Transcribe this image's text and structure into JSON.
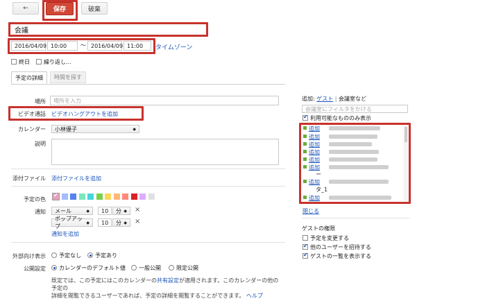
{
  "toolbar": {
    "back_label": "←",
    "save_label": "保存",
    "discard_label": "破棄"
  },
  "event": {
    "title": "会議",
    "start_date": "2016/04/09",
    "start_time": "10:00",
    "range_sep": "〜",
    "end_date": "2016/04/09",
    "end_time": "11:00",
    "timezone_label": "タイムゾーン",
    "allday_label": "終日",
    "repeat_label": "繰り返し..."
  },
  "tabs": {
    "details": "予定の詳細",
    "find_time": "時間を探す"
  },
  "form": {
    "place_label": "場所",
    "place_placeholder": "場所を入力",
    "video_label": "ビデオ通話",
    "video_link": "ビデオハングアウトを追加",
    "calendar_label": "カレンダー",
    "calendar_value": "小林優子",
    "desc_label": "説明",
    "attach_label": "添付ファイル",
    "attach_link": "添付ファイルを追加",
    "color_label": "予定の色",
    "notify_label": "通知",
    "notify1_type": "メール",
    "notify1_num": "10",
    "notify1_unit": "分",
    "notify2_type": "ポップアップ",
    "notify2_num": "10",
    "notify2_unit": "分",
    "add_notify_link": "通知を追加",
    "remove_icon": "×",
    "visibility_label": "外部向け表示",
    "vis_none": "予定なし",
    "vis_busy": "予定あり",
    "privacy_label": "公開設定",
    "priv_default": "カレンダーのデフォルト値",
    "priv_public": "一般公開",
    "priv_private": "限定公開",
    "note_1": "既定では、この予定にはこのカレンダーの",
    "note_share": "共有設定",
    "note_2": "が適用されます。このカレンダーの他の予定の",
    "note_3": "詳細を閲覧できるユーザーであれば、予定の詳細を閲覧することができます。",
    "note_help": "ヘルプ"
  },
  "colors": [
    "#e8a0bf",
    "#a4bdfc",
    "#5484ed",
    "#7ae7bf",
    "#46d6db",
    "#7bd148",
    "#fbd75b",
    "#ffb878",
    "#ff887c",
    "#dc2127",
    "#dbadff",
    "#e1e1e1"
  ],
  "right": {
    "add_prefix": "追加:",
    "guest_link": "ゲスト",
    "sep": "|",
    "room_link": "会議室など",
    "filter_placeholder": "会議室にフィルタをかける",
    "available_only": "利用可能なもののみ表示",
    "room_add_label": "追加",
    "room_dash": "ー",
    "room_tail": "タ_1",
    "close_link": "閉じる",
    "guest_perm_title": "ゲストの権限",
    "perm_modify": "予定を変更する",
    "perm_invite": "他のユーザーを招待する",
    "perm_seelist": "ゲストの一覧を表示する"
  }
}
